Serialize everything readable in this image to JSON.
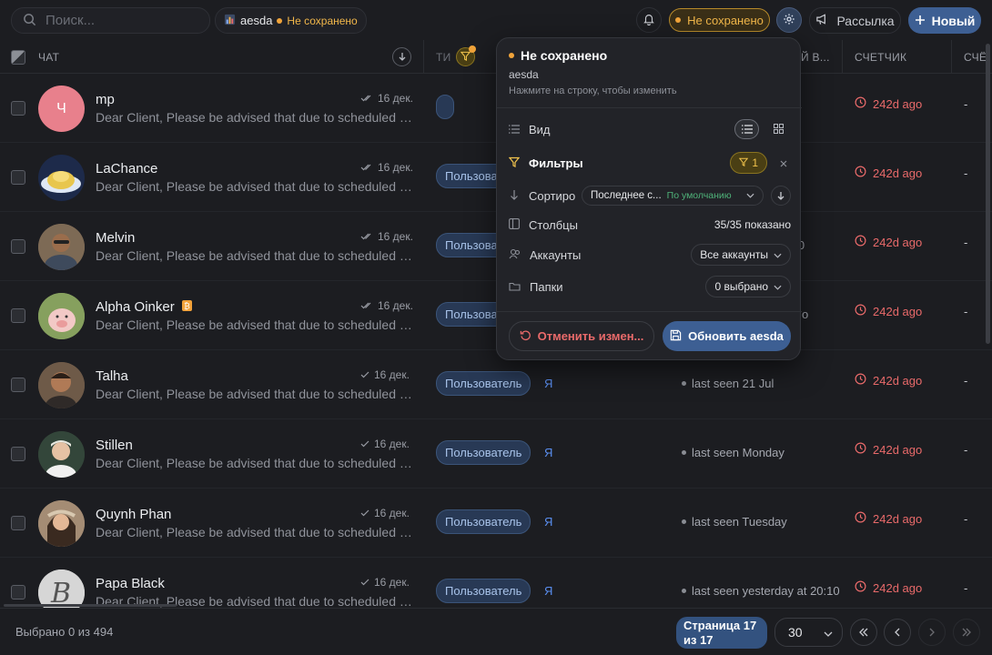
{
  "topbar": {
    "search_placeholder": "Поиск...",
    "view_name": "aesda",
    "view_status": "Не сохранено",
    "unsaved_label": "Не сохранено",
    "broadcast_label": "Рассылка",
    "new_label": "Новый"
  },
  "table": {
    "columns": {
      "chat": "ЧАТ",
      "type": "ТИ",
      "last_seen": "Й В...",
      "counter": "СЧЕТЧИК",
      "counter2": "СЧЁ"
    },
    "rows": [
      {
        "name": "mp",
        "avatar_letter": "Ч",
        "preview": "Dear Client, Please be advised that due to scheduled ma...",
        "date": "16 дек.",
        "type": "",
        "me": "",
        "seen": "",
        "counter": "242d ago",
        "dash": "-"
      },
      {
        "name": "LaChance",
        "avatar_letter": "",
        "preview": "Dear Client, Please be advised that due to scheduled ma...",
        "date": "16 дек.",
        "type": "Пользова",
        "me": "",
        "seen": "",
        "counter": "242d ago",
        "dash": "-"
      },
      {
        "name": "Melvin",
        "avatar_letter": "",
        "preview": "Dear Client, Please be advised that due to scheduled ma...",
        "date": "16 дек.",
        "type": "Пользова",
        "me": "",
        "seen": ":00",
        "counter": "242d ago",
        "dash": "-"
      },
      {
        "name": "Alpha Oinker",
        "avatar_letter": "",
        "preview": "Dear Client, Please be advised that due to scheduled ma...",
        "date": "16 дек.",
        "type": "Пользова",
        "me": "",
        "seen": "o",
        "counter": "242d ago",
        "dash": "-"
      },
      {
        "name": "Talha",
        "avatar_letter": "",
        "preview": "Dear Client, Please be advised that due to scheduled ma...",
        "date": "16 дек.",
        "type": "Пользователь",
        "me": "Я",
        "seen": "last seen 21 Jul",
        "counter": "242d ago",
        "dash": "-"
      },
      {
        "name": "Stillen",
        "avatar_letter": "",
        "preview": "Dear Client, Please be advised that due to scheduled ma...",
        "date": "16 дек.",
        "type": "Пользователь",
        "me": "Я",
        "seen": "last seen Monday",
        "counter": "242d ago",
        "dash": "-"
      },
      {
        "name": "Quynh Phan",
        "avatar_letter": "",
        "preview": "Dear Client, Please be advised that due to scheduled ma...",
        "date": "16 дек.",
        "type": "Пользователь",
        "me": "Я",
        "seen": "last seen Tuesday",
        "counter": "242d ago",
        "dash": "-"
      },
      {
        "name": "Papa Black",
        "avatar_letter": "",
        "preview": "Dear Client, Please be advised that due to scheduled ma...",
        "date": "16 дек.",
        "type": "Пользователь",
        "me": "Я",
        "seen": "last seen yesterday at 20:10",
        "counter": "242d ago",
        "dash": "-"
      }
    ]
  },
  "popup": {
    "title": "Не сохранено",
    "view_name": "aesda",
    "hint": "Нажмите на строку, чтобы изменить",
    "view_label": "Вид",
    "filters_label": "Фильтры",
    "filters_count": "1",
    "sort_label": "Сортиро",
    "sort_value": "Последнее с...",
    "sort_default": "По умолчанию",
    "columns_label": "Столбцы",
    "columns_value": "35/35 показано",
    "accounts_label": "Аккаунты",
    "accounts_value": "Все аккаунты",
    "folders_label": "Папки",
    "folders_value": "0 выбрано",
    "cancel_label": "Отменить измен...",
    "save_label": "Обновить aesda"
  },
  "footer": {
    "selected": "Выбрано 0 из 494",
    "page_line1": "Страница 17",
    "page_line2": "из 17",
    "per_page": "30"
  },
  "colors": {
    "accent": "#3d5f93",
    "warning": "#f2b74a",
    "danger": "#e96a6a",
    "background": "#1c1d21"
  }
}
